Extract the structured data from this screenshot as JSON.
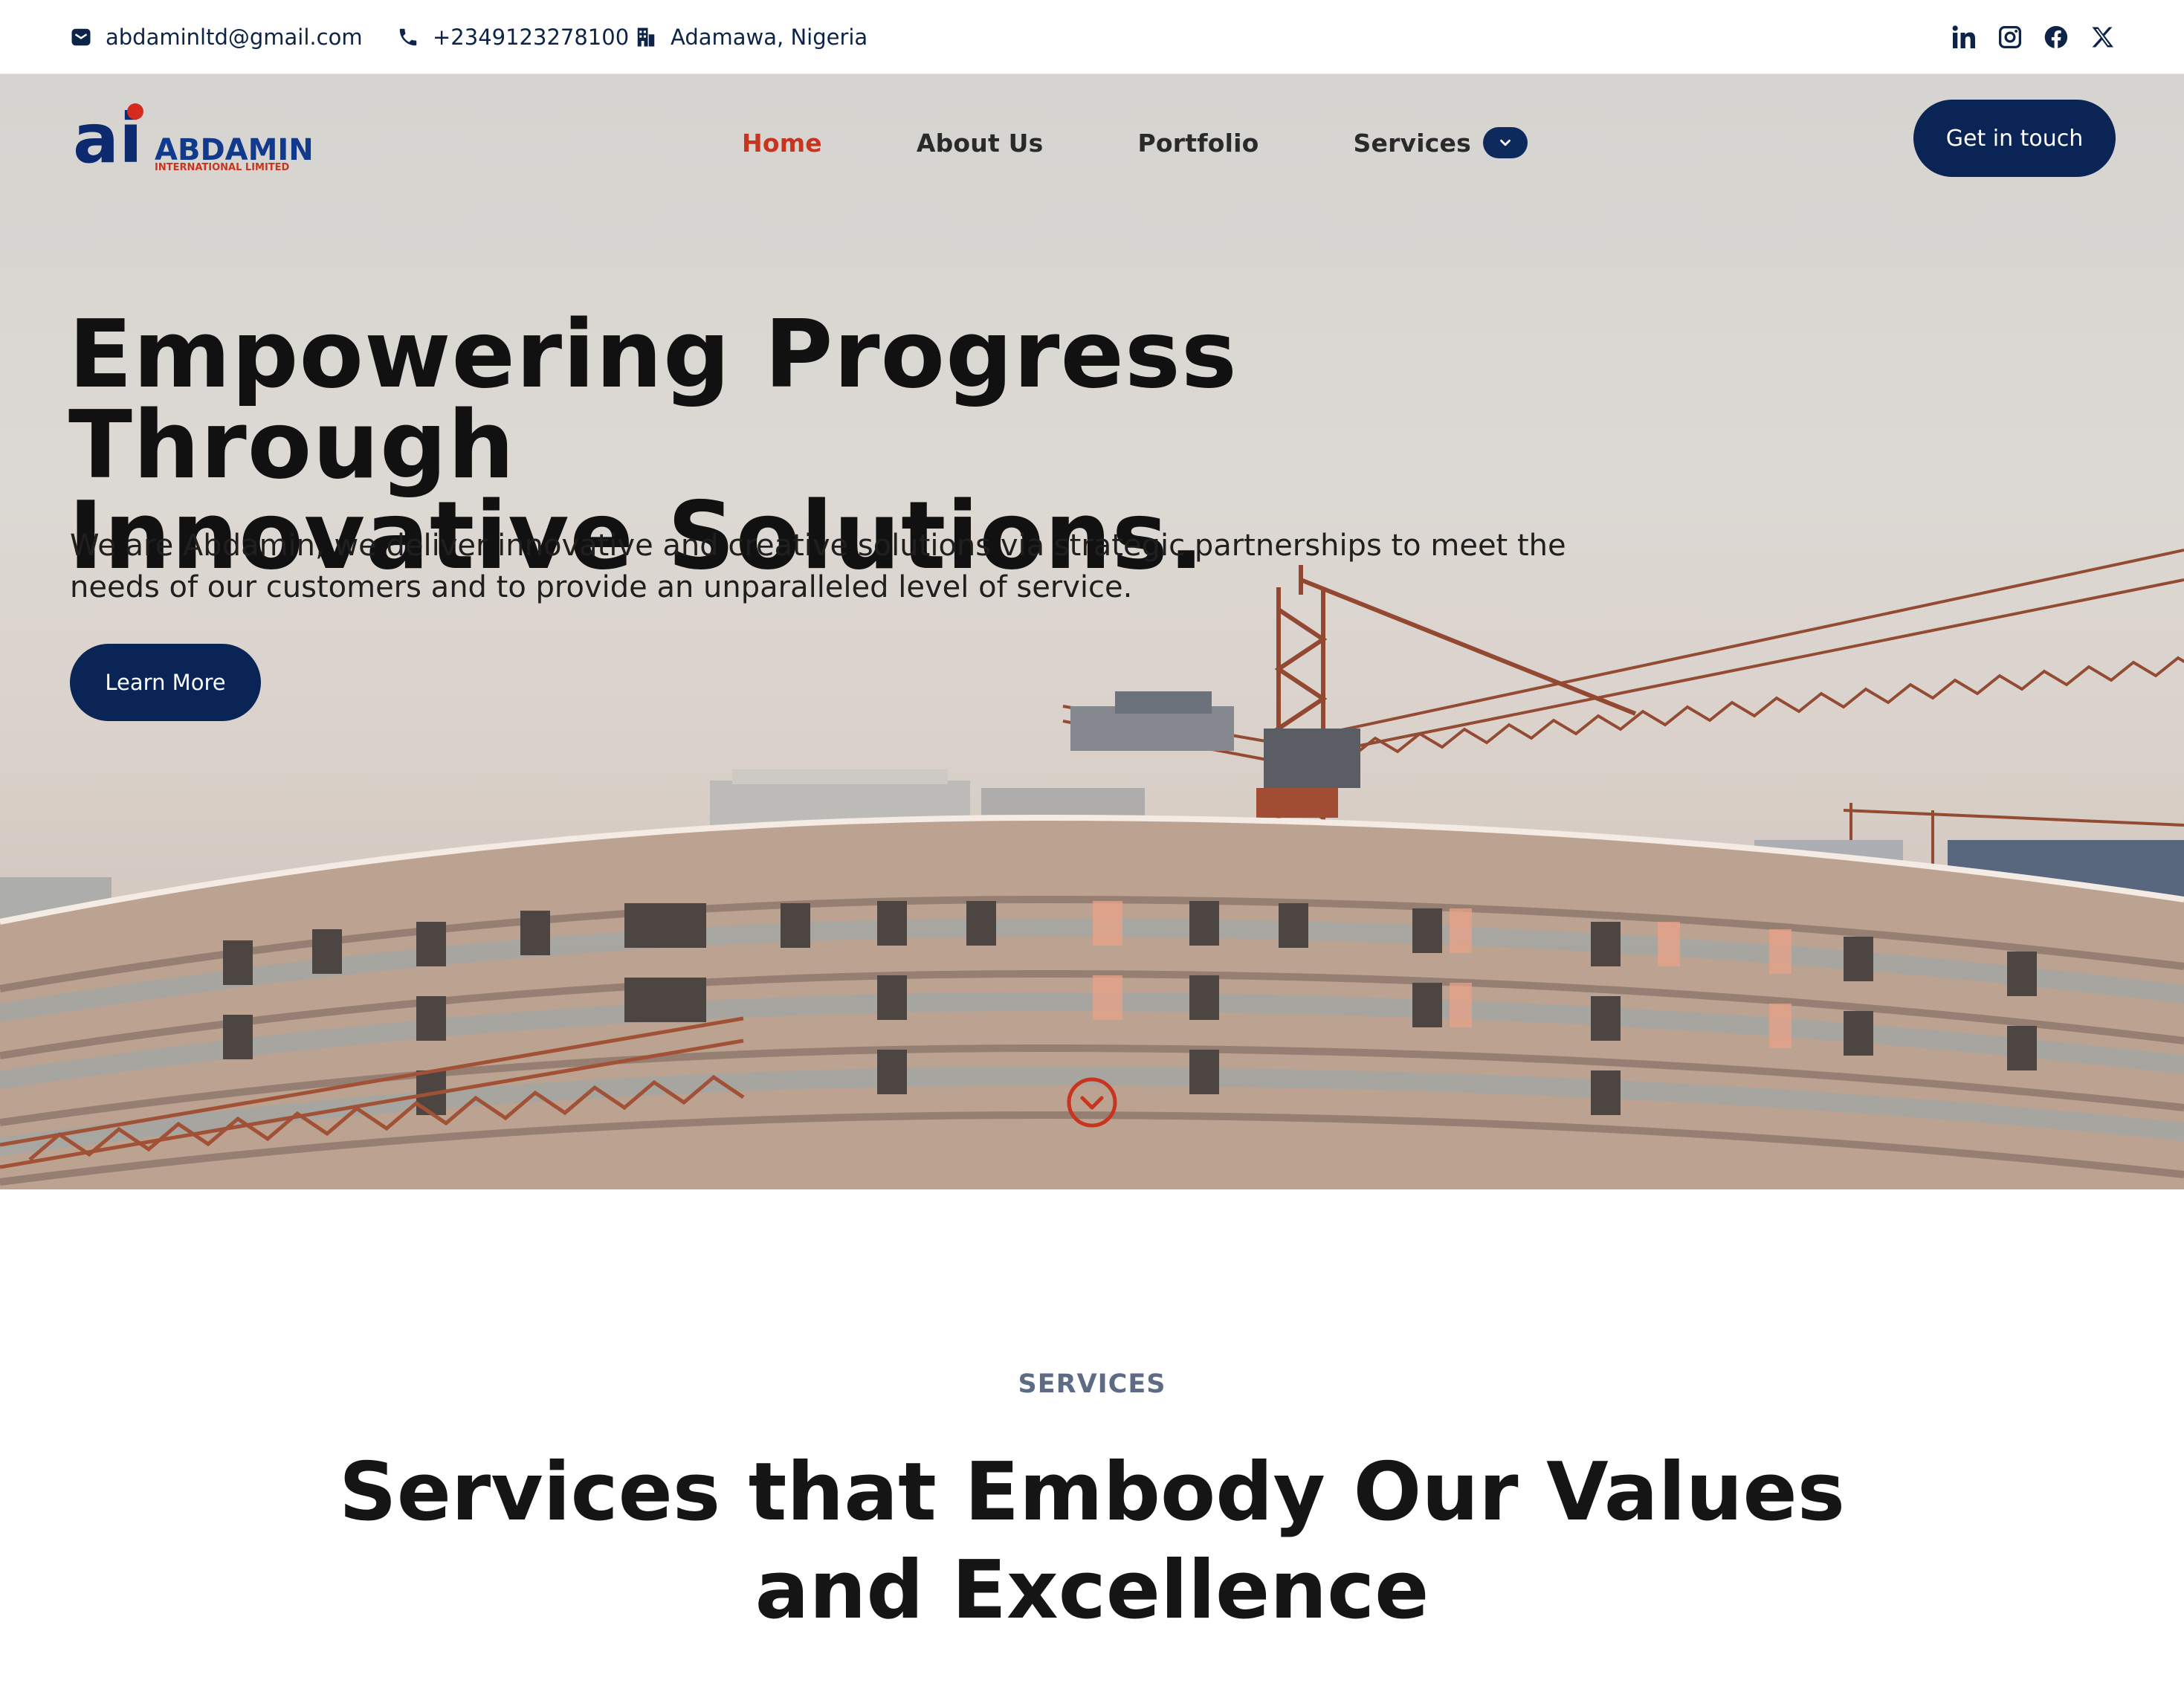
{
  "topbar": {
    "email": "abdaminltd@gmail.com",
    "phone": "+2349123278100",
    "address": "Adamawa, Nigeria",
    "socials": [
      "linkedin-icon",
      "instagram-icon",
      "facebook-icon",
      "x-icon"
    ]
  },
  "brand": {
    "name": "ABDAMIN",
    "tagline": "INTERNATIONAL LIMITED",
    "primary_color": "#0a2456",
    "accent_color": "#c9341e"
  },
  "nav": {
    "items": [
      "Home",
      "About Us",
      "Portfolio",
      "Services"
    ],
    "active": "Home",
    "cta": "Get in touch"
  },
  "hero": {
    "title_line1": "Empowering Progress Through",
    "title_line2": "Innovative Solutions.",
    "subtitle": "We are Abdamin, we deliver innovative and creative solutions via strategic partnerships to meet the needs of our customers and to provide an unparalleled level of service.",
    "button": "Learn More"
  },
  "services": {
    "eyebrow": "SERVICES",
    "title": "Services that Embody Our Values and Excellence"
  }
}
